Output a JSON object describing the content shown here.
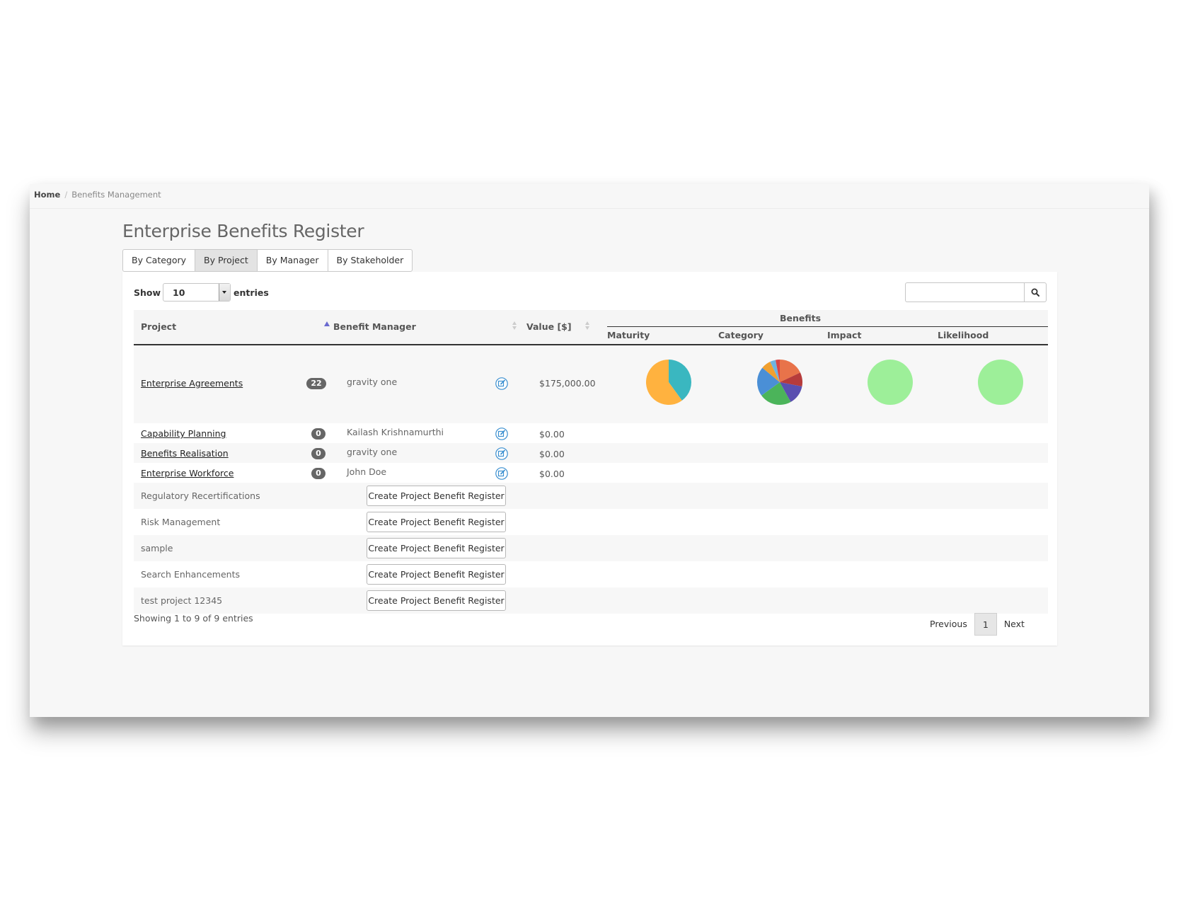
{
  "breadcrumb": {
    "home": "Home",
    "separator": "/",
    "current": "Benefits Management"
  },
  "page": {
    "title": "Enterprise Benefits Register"
  },
  "tabs": [
    {
      "label": "By Category",
      "active": false
    },
    {
      "label": "By Project",
      "active": true
    },
    {
      "label": "By Manager",
      "active": false
    },
    {
      "label": "By Stakeholder",
      "active": false
    }
  ],
  "length_control": {
    "show": "Show",
    "value": "10",
    "entries": "entries"
  },
  "search": {
    "placeholder": "",
    "icon": "search-icon"
  },
  "table": {
    "headers": {
      "project": "Project",
      "manager": "Benefit Manager",
      "value": "Value [$]",
      "benefits": "Benefits",
      "maturity": "Maturity",
      "category": "Category",
      "impact": "Impact",
      "likelihood": "Likelihood"
    },
    "registered": [
      {
        "project": "Enterprise Agreements",
        "count": "22",
        "manager": "gravity one",
        "value": "$175,000.00",
        "charts": {
          "maturity": [
            {
              "value": 40,
              "color": "#3ab7c0"
            },
            {
              "value": 60,
              "color": "#ffb23f"
            }
          ],
          "category": [
            {
              "value": 18,
              "color": "#e8734a"
            },
            {
              "value": 10,
              "color": "#b63b3b"
            },
            {
              "value": 14,
              "color": "#5a4fb0"
            },
            {
              "value": 23,
              "color": "#4bb45a"
            },
            {
              "value": 21,
              "color": "#4a8fd6"
            },
            {
              "value": 7,
              "color": "#f0a030"
            },
            {
              "value": 4,
              "color": "#6fb3e0"
            },
            {
              "value": 3,
              "color": "#d84545"
            }
          ],
          "impact": [
            {
              "value": 100,
              "color": "#9def99"
            }
          ],
          "likelihood": [
            {
              "value": 100,
              "color": "#9def99"
            }
          ]
        }
      },
      {
        "project": "Capability Planning",
        "count": "0",
        "manager": "Kailash Krishnamurthi",
        "value": "$0.00"
      },
      {
        "project": "Benefits Realisation",
        "count": "0",
        "manager": "gravity one",
        "value": "$0.00"
      },
      {
        "project": "Enterprise Workforce",
        "count": "0",
        "manager": "John Doe",
        "value": "$0.00"
      }
    ],
    "unregistered": [
      {
        "project": "Regulatory Recertifications",
        "button": "Create Project Benefit Register"
      },
      {
        "project": "Risk Management",
        "button": "Create Project Benefit Register"
      },
      {
        "project": "sample",
        "button": "Create Project Benefit Register"
      },
      {
        "project": "Search Enhancements",
        "button": "Create Project Benefit Register"
      },
      {
        "project": "test project 12345",
        "button": "Create Project Benefit Register"
      }
    ]
  },
  "footer": {
    "info": "Showing 1 to 9 of 9 entries",
    "previous": "Previous",
    "page": "1",
    "next": "Next"
  }
}
